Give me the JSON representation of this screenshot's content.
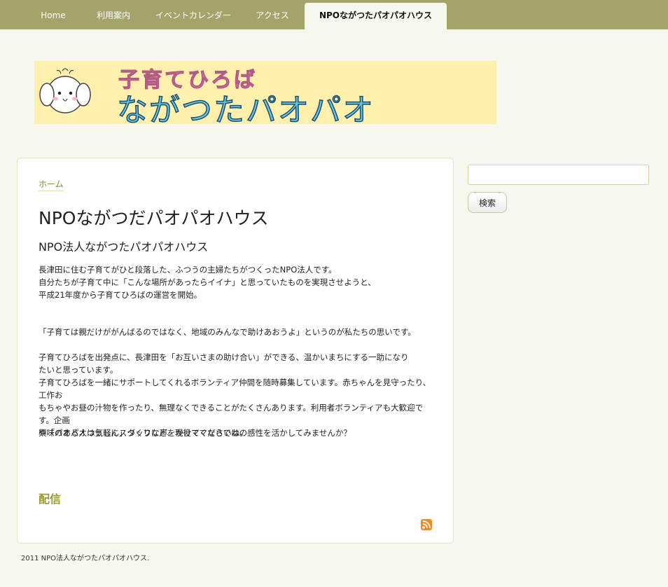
{
  "nav": {
    "items": [
      {
        "label": "Home"
      },
      {
        "label": "利用案内"
      },
      {
        "label": "イベントカレンダー"
      },
      {
        "label": "アクセス"
      },
      {
        "label": "NPOながつたパオパオハウス"
      }
    ]
  },
  "banner": {
    "subtitle": "子育てひろば",
    "title": "ながつたパオパオ"
  },
  "breadcrumb": {
    "home": "ホーム"
  },
  "page": {
    "title": "NPOながつだパオパオハウス",
    "subtitle": "NPO法人ながつたパオパオハウス",
    "paragraphs": [
      "長津田に住む子育てがひと段落した、ふつうの主婦たちがつくったNPO法人です。\n自分たちが子育て中に「こんな場所があったらイイナ」と思っていたものを実現させようと、\n平成21年度から子育てひろばの運営を開始。",
      "「子育ては親だけががんばるのではなく、地域のみんなで助けあおうよ」というのが私たちの思いです。",
      "子育てひろばを出発点に、長津田を「お互いさまの助け合い」ができる、温かいまちにする一助になり\nたいと思っています。\n子育てひろばを一緒にサポートしてくれるボランティア仲間を随時募集しています。赤ちゃんを見守ったり、工作お\nもちゃやお昼の汁物を作ったり、無理なくできることがたくさんあります。利用者ボランティアも大歓迎です。企画\nや「パオパオつうしん」づくりなど、現役ママならではの感性を活かしてみませんか？",
      "興味のある人は気軽にスタッフに声をかけてくださいね。"
    ],
    "feed_heading": "配信"
  },
  "sidebar": {
    "search_placeholder": "",
    "search_button": "検索"
  },
  "footer": {
    "text": "2011 NPO法人ながつたパオパオハウス."
  },
  "colors": {
    "nav_bg": "#a2a469",
    "page_bg": "#f6f7ee",
    "banner_bg": "#fff0ad",
    "accent": "#9a9a35"
  }
}
